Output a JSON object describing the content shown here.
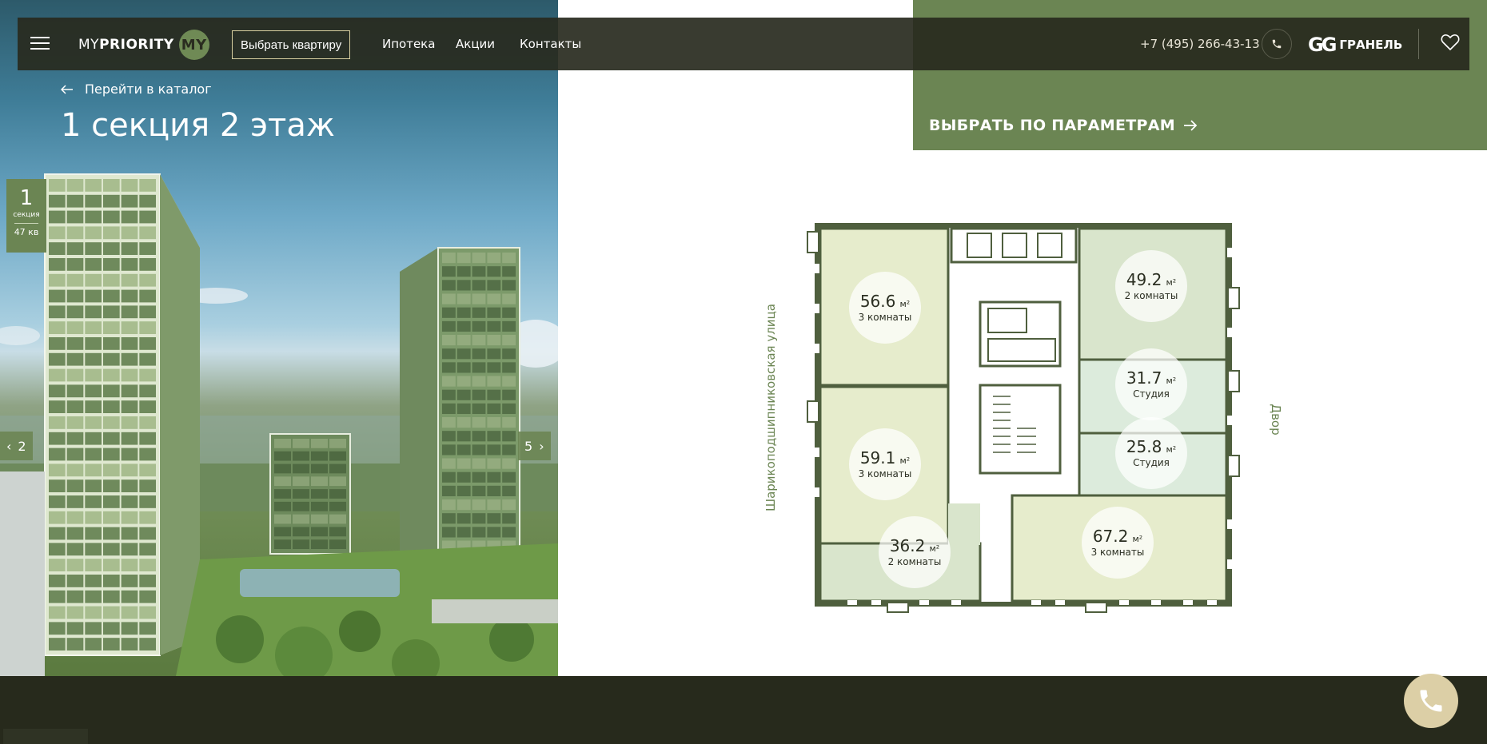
{
  "header": {
    "logo_prefix": "MY",
    "logo_name": "PRIORITY",
    "logo_badge": "MY",
    "choose_button": "Выбрать квартиру",
    "nav": [
      "Ипотека",
      "Акции",
      "Контакты"
    ],
    "phone": "+7 (495) 266-43-13",
    "developer_mark": "GG",
    "developer_name": "ГРАНЕЛЬ"
  },
  "hero": {
    "back_link": "Перейти в каталог",
    "title": "1 секция 2 этаж",
    "section_card": {
      "number": "1",
      "label": "секция",
      "count": "47 кв"
    },
    "prev_section": "2",
    "next_section": "5"
  },
  "filter_link": "ВЫБРАТЬ ПО ПАРАМЕТРАМ",
  "plan": {
    "street_label": "Шарикоподшипниковская улица",
    "yard_label": "Двор",
    "apartments": [
      {
        "area": "56.6",
        "unit": "м²",
        "rooms": "3 комнаты"
      },
      {
        "area": "49.2",
        "unit": "м²",
        "rooms": "2 комнаты"
      },
      {
        "area": "31.7",
        "unit": "м²",
        "rooms": "Студия"
      },
      {
        "area": "25.8",
        "unit": "м²",
        "rooms": "Студия"
      },
      {
        "area": "59.1",
        "unit": "м²",
        "rooms": "3 комнаты"
      },
      {
        "area": "36.2",
        "unit": "м²",
        "rooms": "2 комнаты"
      },
      {
        "area": "67.2",
        "unit": "м²",
        "rooms": "3 комнаты"
      }
    ]
  },
  "colors": {
    "accent_green": "#6b8553",
    "header_bg": "#28291e",
    "footer_bg": "#272a1c",
    "call_button": "#dccfa6"
  }
}
